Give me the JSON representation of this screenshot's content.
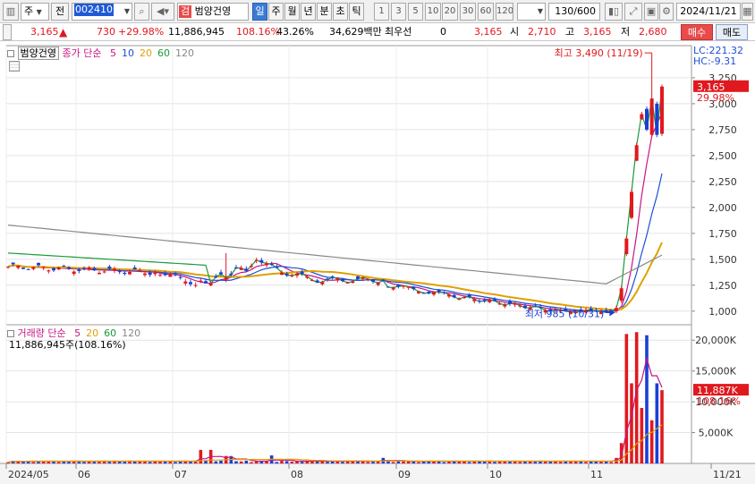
{
  "toolbar": {
    "period_label": "주",
    "prev_label": "전",
    "code": "002410",
    "stock_name": "범양건영",
    "stock_badge": "검",
    "periods": [
      "일",
      "주",
      "월",
      "년",
      "분",
      "초",
      "틱"
    ],
    "intervals": [
      "1",
      "3",
      "5",
      "10",
      "20",
      "30",
      "60",
      "120"
    ],
    "count": "130/600",
    "date": "2024/11/21"
  },
  "quote": {
    "price": "3,165",
    "change": "730",
    "change_pct": "+29.98%",
    "volume": "11,886,945",
    "volume_ratio": "108.16%",
    "turnover": "43.26%",
    "amount": "34,629백만",
    "preferred_label": "최우선",
    "preferred_value": "0",
    "current": "3,165",
    "open_label": "시",
    "open": "2,710",
    "high_label": "고",
    "high": "3,165",
    "low_label": "저",
    "low": "2,680",
    "buy_label": "매수",
    "sell_label": "매도"
  },
  "price_panel": {
    "name_tag": "범양건영",
    "ma_legend_prefix": "종가 단순",
    "ma_periods": [
      "5",
      "10",
      "20",
      "60",
      "120"
    ],
    "ma_colors": [
      "#c71585",
      "#1e4fd6",
      "#e0a000",
      "#1a9a3a",
      "#888888"
    ],
    "lc": "LC:221.32",
    "hc": "HC:-9.31",
    "high_annotation": "최고 3,490 (11/19)",
    "low_annotation": "최저 985 (10/31)",
    "current_tag": "3,165",
    "current_pct": "29.98%"
  },
  "volume_panel": {
    "legend_prefix": "거래량",
    "legend_simple": "단순",
    "ma_periods": [
      "5",
      "20",
      "60",
      "120"
    ],
    "ma_colors": [
      "#c71585",
      "#e0a000",
      "#1a9a3a",
      "#888888"
    ],
    "summary": "11,886,945주(108.16%)",
    "current_tag": "11,887K",
    "current_pct": "108.16%"
  },
  "x_axis": {
    "labels": [
      "2024/05",
      "06",
      "07",
      "08",
      "09",
      "10",
      "11",
      "11/21"
    ]
  },
  "chart_data": {
    "type": "candlestick",
    "price_axis": {
      "ticks": [
        "3,250",
        "3,000",
        "2,750",
        "2,500",
        "2,250",
        "2,000",
        "1,750",
        "1,500",
        "1,250",
        "1,000"
      ],
      "ylim": [
        860,
        3560
      ]
    },
    "volume_axis": {
      "ticks": [
        "20,000K",
        "15,000K",
        "10,000K",
        "5,000K"
      ],
      "ylim": [
        0,
        22500
      ]
    },
    "highlights": [
      {
        "date": "11/19",
        "label": "최고",
        "value": 3490
      },
      {
        "date": "10/31",
        "label": "최저",
        "value": 985
      }
    ]
  },
  "colors": {
    "up": "#e0191e",
    "down": "#1a3fd6",
    "current_tag_bg": "#e0191e"
  }
}
